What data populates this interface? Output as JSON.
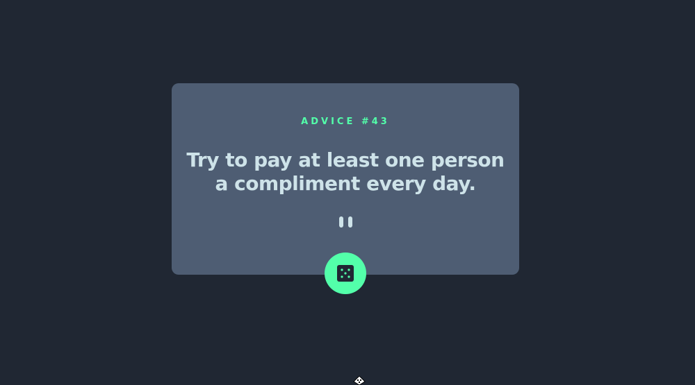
{
  "card": {
    "advice_label": "ADVICE #43",
    "advice_text": "Try to pay at least one person a compliment every day."
  },
  "dice_button": {
    "icon": "dice-icon",
    "color": "#53ffaa"
  },
  "colors": {
    "background": "#202733",
    "card": "#4e5d73",
    "accent": "#53ffaa",
    "text": "#cee3e9"
  }
}
